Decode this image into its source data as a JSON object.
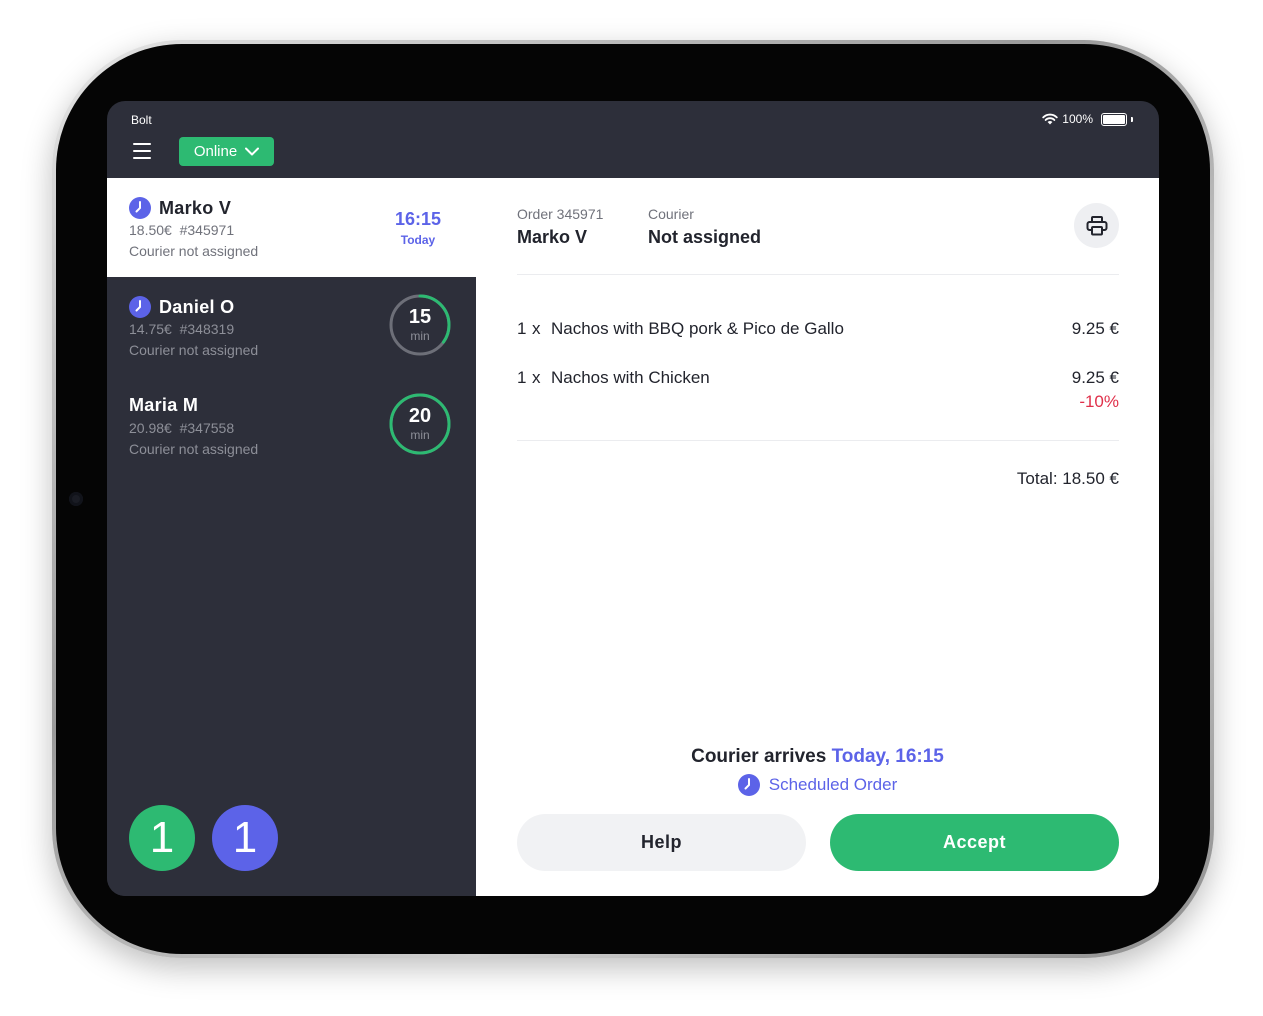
{
  "status_bar": {
    "app_name": "Bolt",
    "battery": "100%"
  },
  "topbar": {
    "status_label": "Online"
  },
  "orders": [
    {
      "name": "Marko V",
      "meta": "18.50€  #345971",
      "status": "Courier not assigned",
      "time": "16:15",
      "day": "Today"
    },
    {
      "name": "Daniel O",
      "meta": "14.75€  #348319",
      "status": "Courier not assigned",
      "minutes": "15",
      "unit": "min",
      "progress": 0.35
    },
    {
      "name": "Maria M",
      "meta": "20.98€  #347558",
      "status": "Courier not assigned",
      "minutes": "20",
      "unit": "min",
      "progress": 1.0
    }
  ],
  "counters": {
    "green": "1",
    "blue": "1"
  },
  "detail": {
    "order_label": "Order 345971",
    "customer": "Marko V",
    "courier_label": "Courier",
    "courier_value": "Not assigned",
    "items": [
      {
        "qty": "1",
        "x": "x",
        "name": "Nachos with BBQ pork & Pico de Gallo",
        "price": "9.25 €"
      },
      {
        "qty": "1",
        "x": "x",
        "name": "Nachos with Chicken",
        "price": "9.25 €",
        "discount": "-10%"
      }
    ],
    "total": "Total: 18.50 €",
    "arrival_prefix": "Courier arrives",
    "arrival_when": "Today, 16:15",
    "scheduled": "Scheduled Order",
    "help": "Help",
    "accept": "Accept"
  },
  "colors": {
    "green": "#2dba72",
    "blue": "#5c63e8",
    "sidebar": "#2d2f3a",
    "discount": "#e0304a"
  },
  "icons": [
    "menu-icon",
    "chevron-down-icon",
    "wifi-icon",
    "battery-icon",
    "clock-icon",
    "printer-icon"
  ]
}
